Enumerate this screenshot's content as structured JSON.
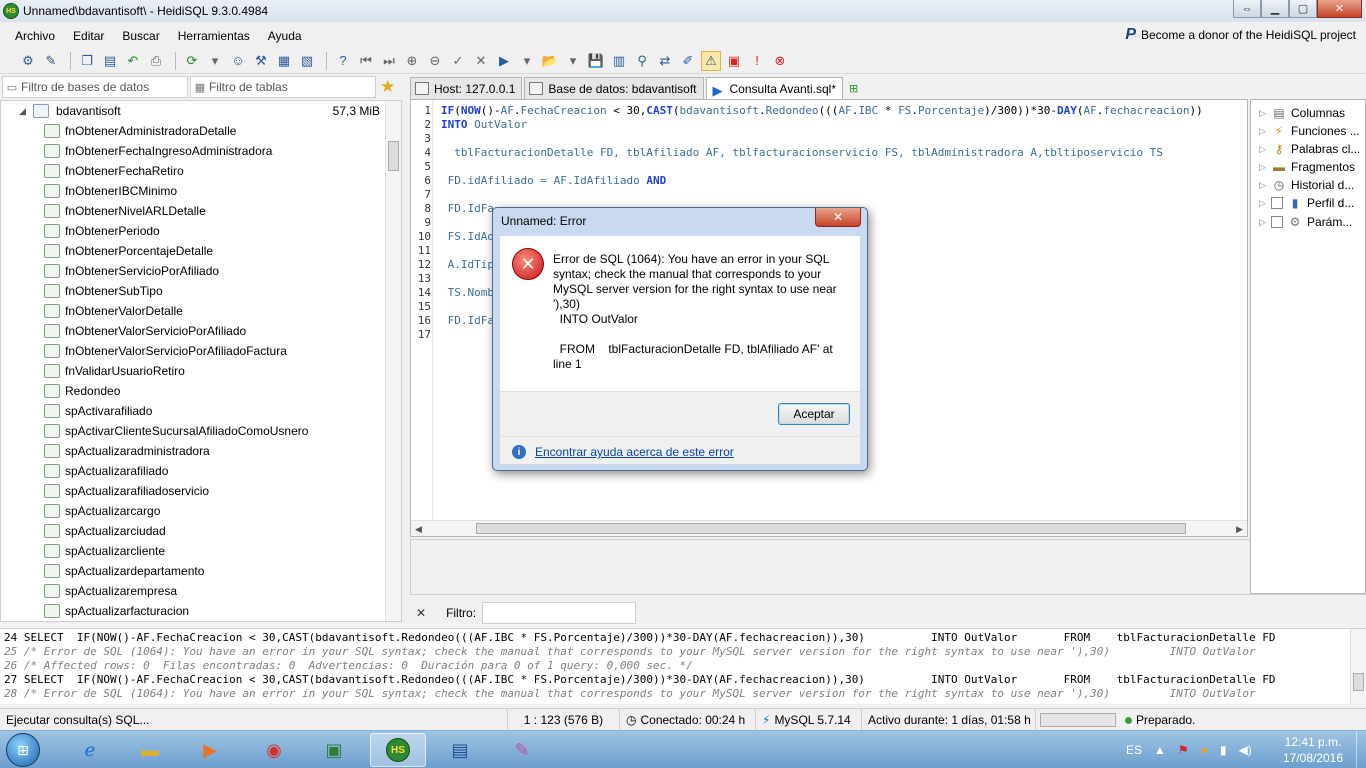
{
  "window": {
    "title": "Unnamed\\bdavantisoft\\ - HeidiSQL 9.3.0.4984",
    "app_icon": "HS"
  },
  "menu": [
    "Archivo",
    "Editar",
    "Buscar",
    "Herramientas",
    "Ayuda"
  ],
  "donor_text": "Become a donor of the HeidiSQL project",
  "filters": {
    "db_filter_placeholder": "Filtro de bases de datos",
    "table_filter_placeholder": "Filtro de tablas"
  },
  "tree": {
    "database": "bdavantisoft",
    "size": "57,3 MiB",
    "items": [
      "fnObtenerAdministradoraDetalle",
      "fnObtenerFechaIngresoAdministradora",
      "fnObtenerFechaRetiro",
      "fnObtenerIBCMinimo",
      "fnObtenerNivelARLDetalle",
      "fnObtenerPeriodo",
      "fnObtenerPorcentajeDetalle",
      "fnObtenerServicioPorAfiliado",
      "fnObtenerSubTipo",
      "fnObtenerValorDetalle",
      "fnObtenerValorServicioPorAfiliado",
      "fnObtenerValorServicioPorAfiliadoFactura",
      "fnValidarUsuarioRetiro",
      "Redondeo",
      "spActivarafiliado",
      "spActivarClienteSucursalAfiliadoComoUsnero",
      "spActualizaradministradora",
      "spActualizarafiliado",
      "spActualizarafiliadoservicio",
      "spActualizarcargo",
      "spActualizarciudad",
      "spActualizarcliente",
      "spActualizardepartamento",
      "spActualizarempresa",
      "spActualizarfacturacion"
    ]
  },
  "tabs": [
    {
      "label": "Host: 127.0.0.1"
    },
    {
      "label": "Base de datos: bdavantisoft"
    },
    {
      "label": "Consulta Avanti.sql*"
    }
  ],
  "editor": {
    "line_numbers": [
      "1",
      "2",
      "3",
      "4",
      "5",
      "6",
      "7",
      "8",
      "9",
      "10",
      "11",
      "12",
      "13",
      "14",
      "15",
      "16",
      "17"
    ],
    "line1": "IF(NOW()-AF.FechaCreacion < 30,CAST(bdavantisoft.Redondeo(((AF.IBC * FS.Porcentaje)/300))*30-DAY(AF.fechacreacion))",
    "line2": "INTO OutValor",
    "line4": "  tblFacturacionDetalle FD, tblAfiliado AF, tblfacturacionservicio FS, tblAdministradora A,tbltiposervicio TS",
    "line6": " FD.idAfiliado = AF.IdAfiliado AND",
    "line8": " FD.IdFa",
    "line10": " FS.IdAd",
    "line12": " A.IdTip",
    "line14": " TS.Nomb",
    "line16": " FD.IdFa"
  },
  "helpers": [
    "Columnas",
    "Funciones ...",
    "Palabras cl...",
    "Fragmentos",
    "Historial d...",
    "Perfil d...",
    "Parám..."
  ],
  "filter_bar": {
    "label": "Filtro:"
  },
  "log": [
    "24 SELECT  IF(NOW()-AF.FechaCreacion < 30,CAST(bdavantisoft.Redondeo(((AF.IBC * FS.Porcentaje)/300))*30-DAY(AF.fechacreacion)),30)          INTO OutValor       FROM    tblFacturacionDetalle FD",
    "25 /* Error de SQL (1064): You have an error in your SQL syntax; check the manual that corresponds to your MySQL server version for the right syntax to use near '),30)         INTO OutValor",
    "26 /* Affected rows: 0  Filas encontradas: 0  Advertencias: 0  Duración para 0 of 1 query: 0,000 sec. */",
    "27 SELECT  IF(NOW()-AF.FechaCreacion < 30,CAST(bdavantisoft.Redondeo(((AF.IBC * FS.Porcentaje)/300))*30-DAY(AF.fechacreacion)),30)          INTO OutValor       FROM    tblFacturacionDetalle FD",
    "28 /* Error de SQL (1064): You have an error in your SQL syntax; check the manual that corresponds to your MySQL server version for the right syntax to use near '),30)         INTO OutValor"
  ],
  "status": {
    "action": "Ejecutar consulta(s) SQL...",
    "position": "1 : 123 (576 B)",
    "connected": "Conectado: 00:24 h",
    "server": "MySQL 5.7.14",
    "uptime": "Activo durante: 1 días, 01:58 h",
    "state": "Preparado."
  },
  "dialog": {
    "title": "Unnamed: Error",
    "message": "Error de SQL (1064): You have an error in your SQL syntax; check the manual that corresponds to your MySQL server version for the right syntax to use near '),30)\n  INTO OutValor\n\n  FROM    tblFacturacionDetalle FD, tblAfiliado AF' at line 1",
    "ok_label": "Aceptar",
    "help_link": "Encontrar ayuda acerca de este error"
  },
  "taskbar": {
    "language": "ES",
    "time": "12:41 p.m.",
    "date": "17/08/2016"
  }
}
